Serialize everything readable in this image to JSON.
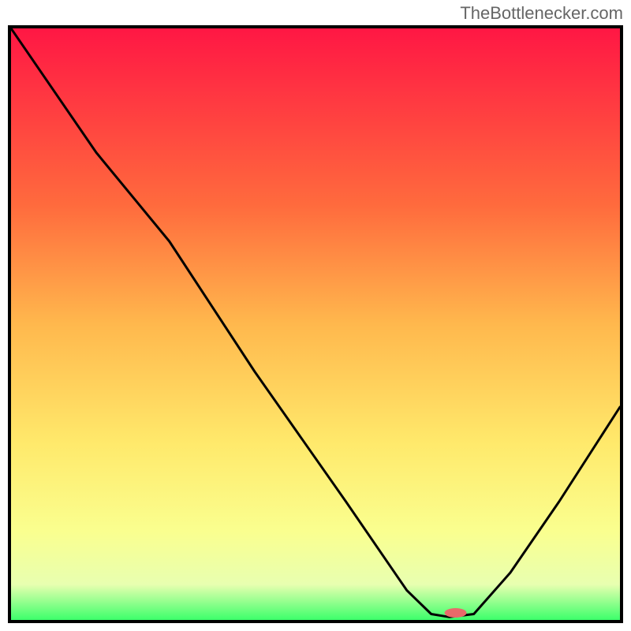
{
  "watermark": "TheBottlenecker.com",
  "chart_data": {
    "type": "line",
    "title": "",
    "xlabel": "",
    "ylabel": "",
    "xlim": [
      0,
      100
    ],
    "ylim": [
      0,
      100
    ],
    "gradient_stops": [
      {
        "offset": 0,
        "color": "#ff1744"
      },
      {
        "offset": 30,
        "color": "#ff6b3d"
      },
      {
        "offset": 50,
        "color": "#ffb84d"
      },
      {
        "offset": 70,
        "color": "#ffe96b"
      },
      {
        "offset": 85,
        "color": "#faff8f"
      },
      {
        "offset": 94,
        "color": "#e8ffb0"
      },
      {
        "offset": 100,
        "color": "#3cff6b"
      }
    ],
    "curve_points": [
      {
        "x": 0,
        "y": 100
      },
      {
        "x": 14,
        "y": 79
      },
      {
        "x": 26,
        "y": 64
      },
      {
        "x": 40,
        "y": 42
      },
      {
        "x": 55,
        "y": 20
      },
      {
        "x": 65,
        "y": 5
      },
      {
        "x": 69,
        "y": 1
      },
      {
        "x": 72,
        "y": 0.5
      },
      {
        "x": 76,
        "y": 1
      },
      {
        "x": 82,
        "y": 8
      },
      {
        "x": 90,
        "y": 20
      },
      {
        "x": 100,
        "y": 36
      }
    ],
    "marker": {
      "x": 73,
      "y": 1.2,
      "color": "#e86a6a",
      "rx": 14,
      "ry": 6
    }
  }
}
